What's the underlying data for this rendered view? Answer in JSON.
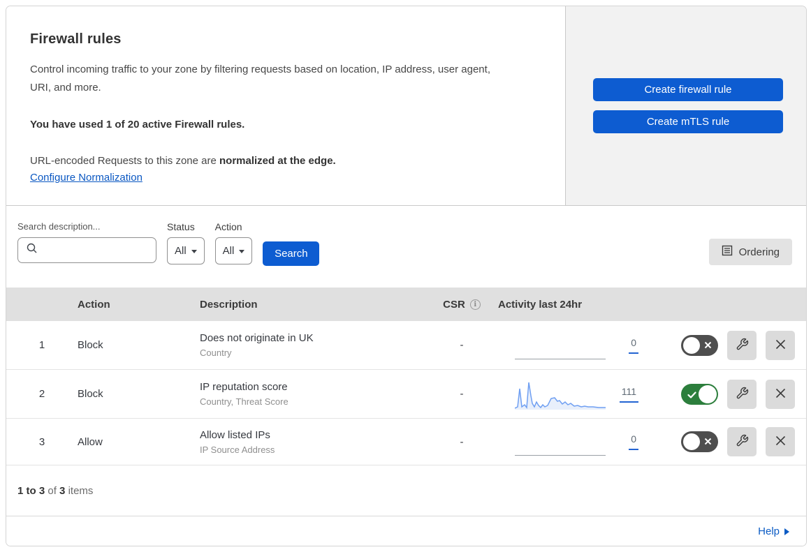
{
  "header": {
    "title": "Firewall rules",
    "description": "Control incoming traffic to your zone by filtering requests based on location, IP address, user agent, URI, and more.",
    "usage_text": "You have used 1 of 20 active Firewall rules.",
    "normalization_prefix": "URL-encoded Requests to this zone are ",
    "normalization_bold": "normalized at the edge.",
    "configure_link": "Configure Normalization",
    "create_firewall_button": "Create firewall rule",
    "create_mtls_button": "Create mTLS rule"
  },
  "filters": {
    "search_label": "Search description...",
    "status_label": "Status",
    "status_value": "All",
    "action_label": "Action",
    "action_value": "All",
    "search_button": "Search",
    "ordering_button": "Ordering"
  },
  "table": {
    "columns": {
      "action": "Action",
      "description": "Description",
      "csr": "CSR",
      "activity": "Activity last 24hr"
    },
    "rows": [
      {
        "num": "1",
        "action": "Block",
        "title": "Does not originate in UK",
        "subtitle": "Country",
        "csr": "-",
        "count": "0",
        "enabled": false
      },
      {
        "num": "2",
        "action": "Block",
        "title": "IP reputation score",
        "subtitle": "Country, Threat Score",
        "csr": "-",
        "count": "111",
        "enabled": true
      },
      {
        "num": "3",
        "action": "Allow",
        "title": "Allow listed IPs",
        "subtitle": "IP Source Address",
        "csr": "-",
        "count": "0",
        "enabled": false
      }
    ]
  },
  "footer": {
    "range": "1 to 3",
    "of_word": "of",
    "total": "3",
    "items_word": "items",
    "help_label": "Help"
  },
  "colors": {
    "primary_blue": "#0d5cd1",
    "link_blue": "#0a57c2",
    "toggle_on_green": "#2c7e3c",
    "toggle_off_gray": "#4e4e4e",
    "panel_gray": "#f2f2f2",
    "table_header_gray": "#e0e0e0",
    "sparkline_blue": "#6f9ff2",
    "count_underline_blue": "#2364d2"
  }
}
